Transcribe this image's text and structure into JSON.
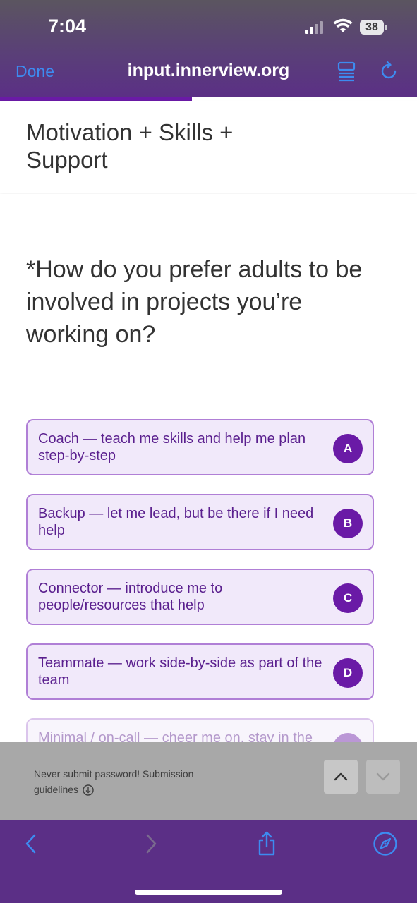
{
  "status_bar": {
    "time": "7:04",
    "battery": "38"
  },
  "browser": {
    "done_label": "Done",
    "url": "input.innerview.org",
    "progress_percent": 46
  },
  "section": {
    "title": "Motivation + Skills + Support"
  },
  "question": {
    "text": "*How do you prefer adults to be involved in projects you’re working on?"
  },
  "options": [
    {
      "key": "A",
      "label": "Coach — teach me skills and help me plan step-by-step"
    },
    {
      "key": "B",
      "label": "Backup — let me lead, but be there if I need help"
    },
    {
      "key": "C",
      "label": "Connector — introduce me to people/resources that help"
    },
    {
      "key": "D",
      "label": "Teammate — work side-by-side as part of the team"
    },
    {
      "key": "",
      "label": "Minimal / on-call — cheer me on, stay in the"
    }
  ],
  "footer_info": {
    "text": "Never submit password! Submission guidelines"
  },
  "colors": {
    "accent": "#6a1aa6",
    "option_bg": "#f1e9fa",
    "toolbar": "#5b2f86",
    "link_blue": "#3d8bf0"
  }
}
